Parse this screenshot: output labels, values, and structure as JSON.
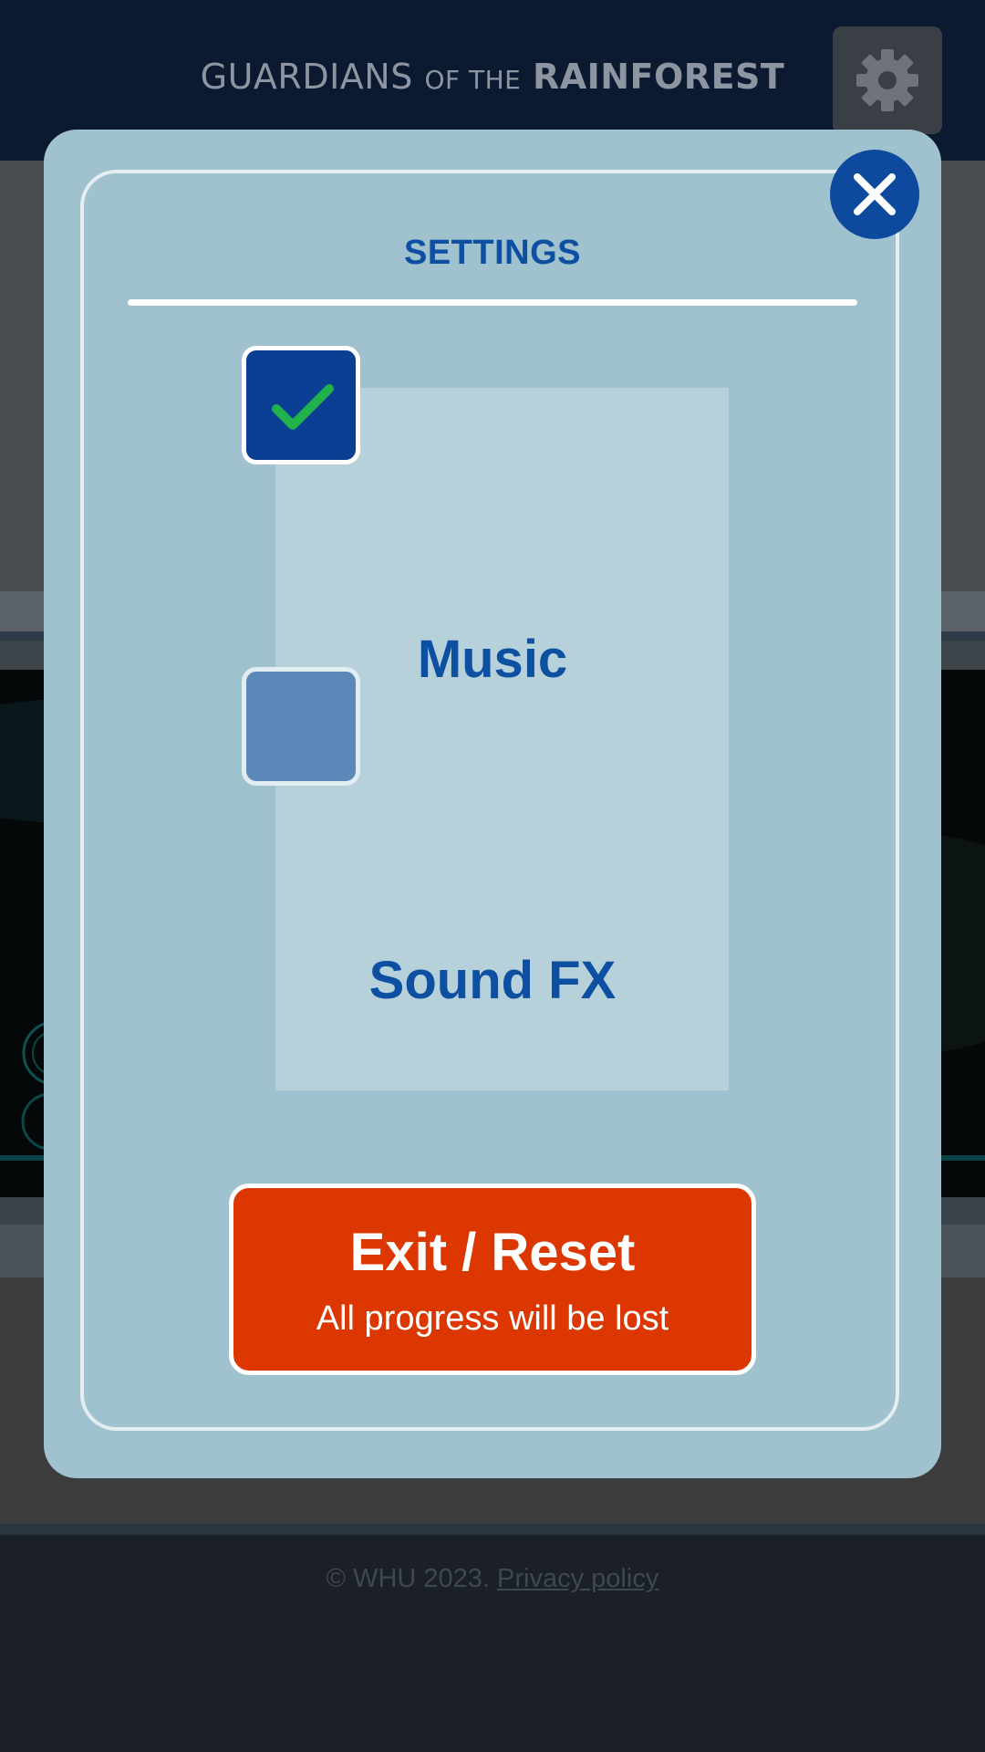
{
  "header": {
    "title_part1": "GUARDIANS",
    "title_part2": "OF THE",
    "title_part3": "RAINFOREST",
    "settings_icon": "gear-icon"
  },
  "modal": {
    "title": "SETTINGS",
    "close_icon": "close-icon",
    "options": [
      {
        "label": "Music",
        "checked": true
      },
      {
        "label": "Sound FX",
        "checked": false
      }
    ],
    "exit_button": {
      "title": "Exit / Reset",
      "subtitle": "All progress will be lost"
    }
  },
  "footer": {
    "copyright": "© WHU 2023.",
    "privacy_link": "Privacy policy"
  },
  "colors": {
    "modal_bg": "#a0c1ce",
    "accent_blue": "#0d4fa0",
    "exit_red": "#dc3700",
    "check_green": "#22b24c"
  }
}
